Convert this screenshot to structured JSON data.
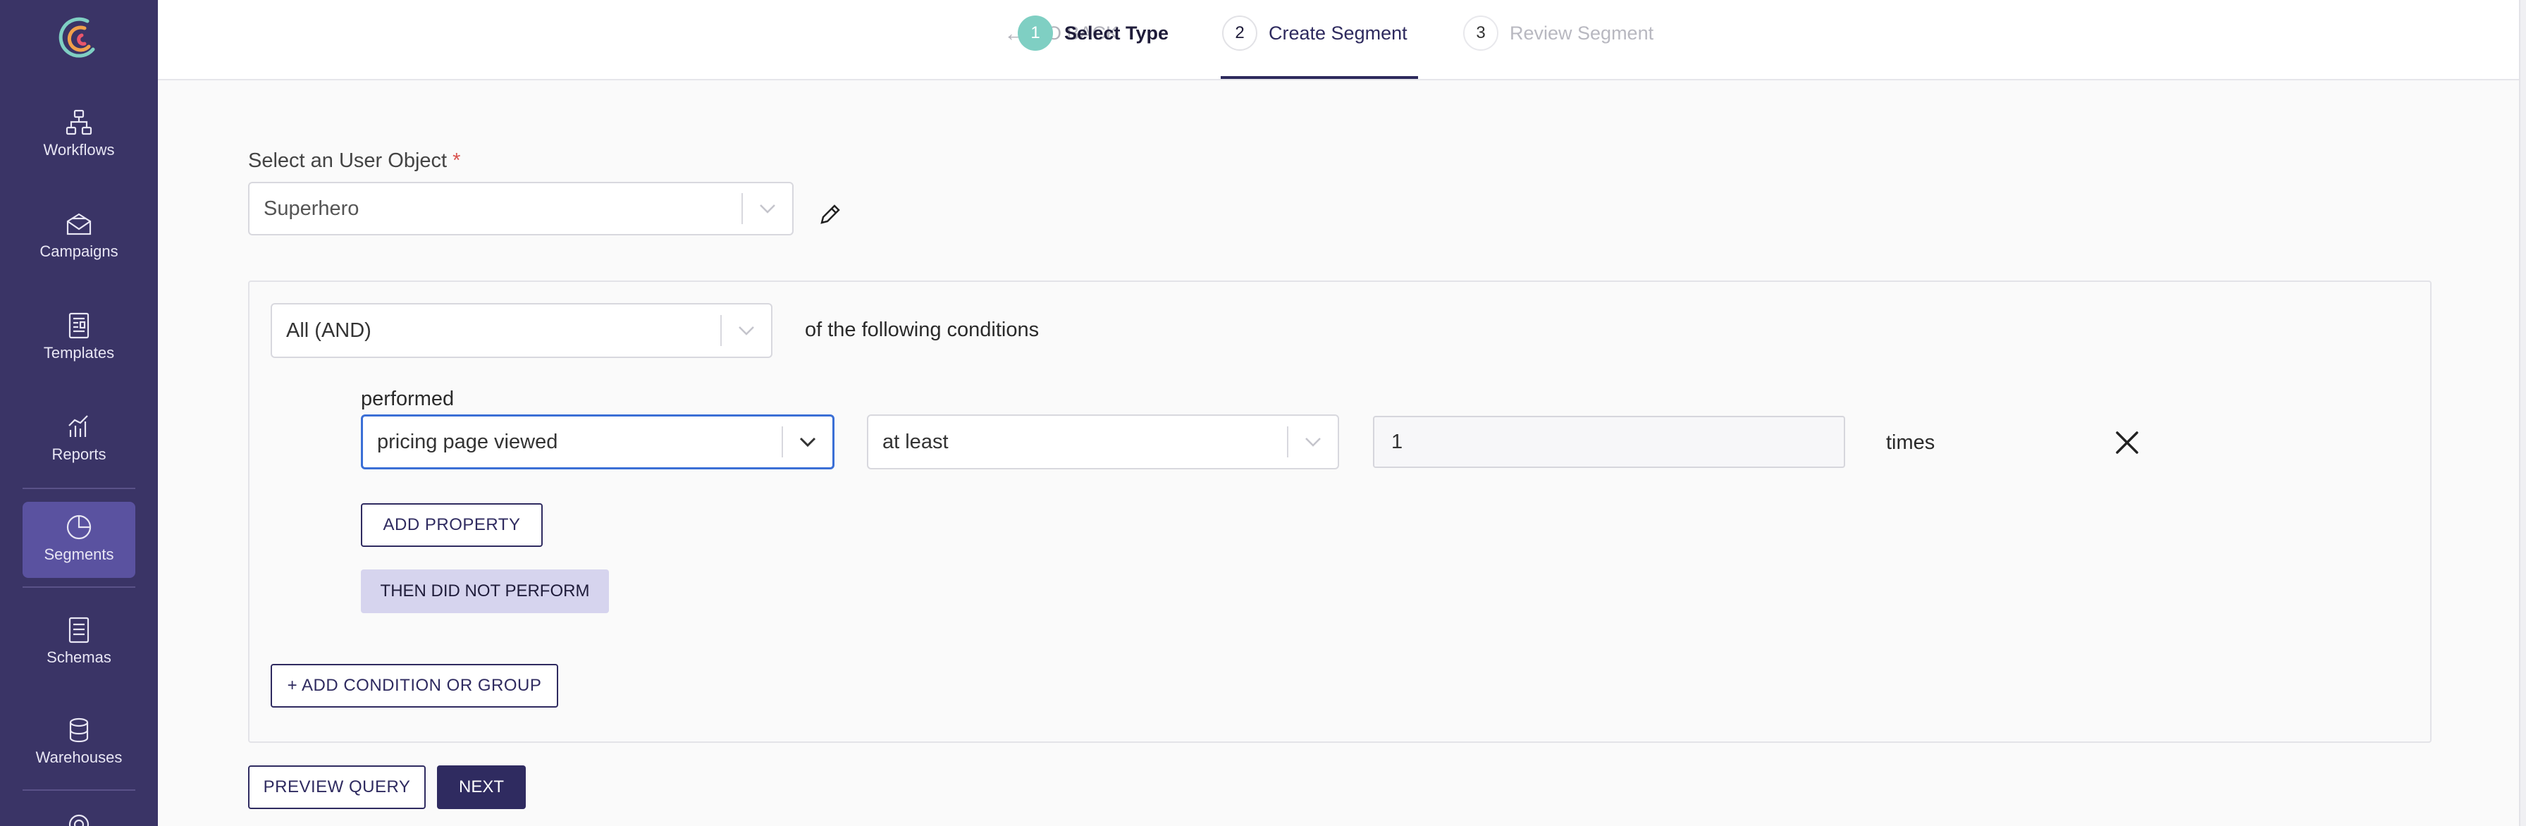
{
  "sidebar": {
    "items": [
      {
        "label": "Workflows",
        "icon": "workflow-icon"
      },
      {
        "label": "Campaigns",
        "icon": "envelope-icon"
      },
      {
        "label": "Templates",
        "icon": "template-icon"
      },
      {
        "label": "Reports",
        "icon": "chart-icon"
      },
      {
        "label": "Segments",
        "icon": "pie-chart-icon",
        "active": true
      },
      {
        "label": "Schemas",
        "icon": "document-icon"
      },
      {
        "label": "Warehouses",
        "icon": "database-icon"
      }
    ],
    "colors": {
      "background": "#3a3466",
      "active": "#5a52a0"
    }
  },
  "stepper": {
    "go_back": "GO BACK",
    "steps": [
      {
        "num": "1",
        "label": "Select Type"
      },
      {
        "num": "2",
        "label": "Create Segment"
      },
      {
        "num": "3",
        "label": "Review Segment"
      }
    ],
    "active_step": "Create Segment",
    "accent": "#7fcfc3"
  },
  "user_object": {
    "label": "Select an User Object",
    "required_mark": "*",
    "value": "Superhero"
  },
  "conditions": {
    "match_value": "All (AND)",
    "match_suffix": "of the following conditions",
    "rule": {
      "prefix": "performed",
      "event": "pricing page viewed",
      "operator": "at least",
      "count": "1",
      "unit": "times"
    },
    "add_property": "ADD PROPERTY",
    "then_did_not_perform": "THEN DID NOT PERFORM",
    "add_condition": "+ ADD CONDITION OR GROUP"
  },
  "footer": {
    "preview": "PREVIEW QUERY",
    "next": "NEXT"
  }
}
